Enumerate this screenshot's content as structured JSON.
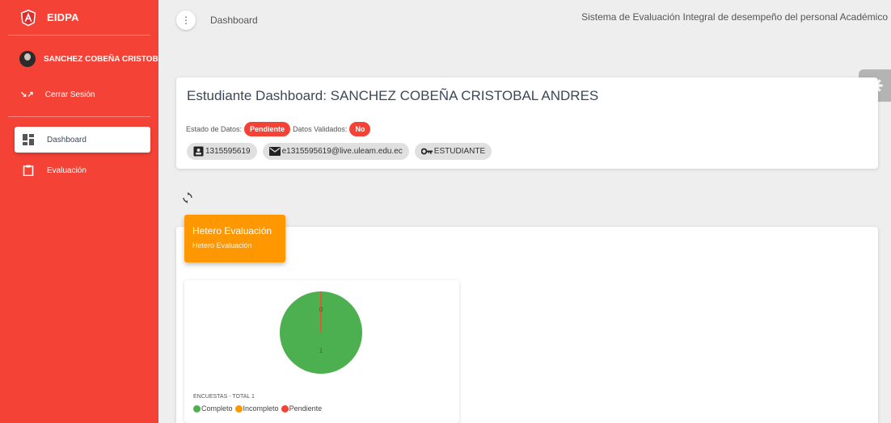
{
  "sidebar": {
    "brand": "EIDPA",
    "user_name": "SANCHEZ COBEÑA CRISTOBAL",
    "logout_label": "Cerrar Sesión",
    "items": [
      {
        "label": "Dashboard",
        "icon": "dashboard-icon",
        "active": true
      },
      {
        "label": "Evaluación",
        "icon": "clipboard-icon",
        "active": false
      }
    ]
  },
  "header": {
    "menu_icon": "more-vert-icon",
    "breadcrumb": "Dashboard",
    "system_title": "Sistema de Evaluación Integral de desempeño del personal Académico"
  },
  "student": {
    "title": "Estudiante Dashboard: SANCHEZ COBEÑA CRISTOBAL ANDRES",
    "estado_label": "Estado de Datos:",
    "estado_value": "Pendiente",
    "validados_label": "Datos Validados:",
    "validados_value": "No",
    "chips": [
      {
        "icon": "id-card-icon",
        "text": "1315595619"
      },
      {
        "icon": "mail-icon",
        "text": "e1315595619@live.uleam.edu.ec"
      },
      {
        "icon": "key-icon",
        "text": "ESTUDIANTE"
      }
    ]
  },
  "hetero": {
    "title": "Hetero Evaluación",
    "subtitle": "Hetero Evaluación"
  },
  "chart": {
    "total_label": "ENCUESTAS - TOTAL 1",
    "legend": [
      {
        "label": "Completo",
        "color": "#4caf50"
      },
      {
        "label": "Incompleto",
        "color": "#ff9800"
      },
      {
        "label": "Pendiente",
        "color": "#f44336"
      }
    ]
  },
  "chart_data": {
    "type": "pie",
    "categories": [
      "Completo",
      "Incompleto",
      "Pendiente"
    ],
    "values": [
      1,
      0,
      0
    ],
    "data_labels": [
      "1",
      "0",
      "0"
    ]
  },
  "colors": {
    "sidebar": "#f44336",
    "accent_orange": "#ff9800",
    "green": "#4caf50"
  }
}
